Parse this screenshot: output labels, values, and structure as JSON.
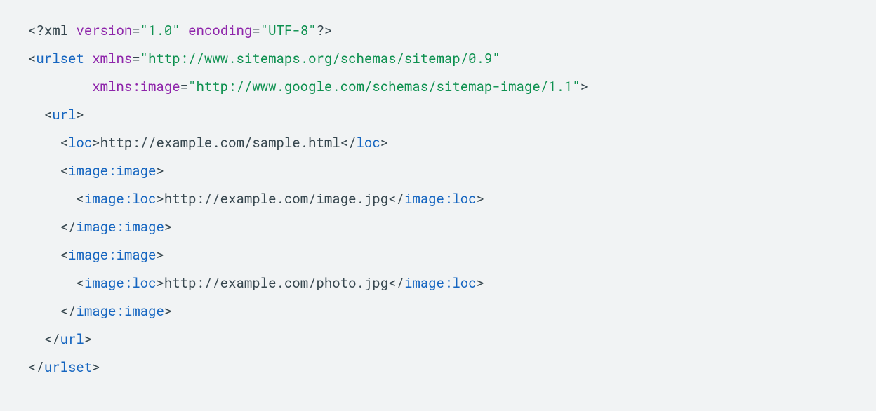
{
  "code": {
    "indent": "  ",
    "xml_decl": {
      "open": "<?",
      "name": "xml",
      "attrs": [
        {
          "name": "version",
          "value": "1.0"
        },
        {
          "name": "encoding",
          "value": "UTF-8"
        }
      ],
      "close": "?>"
    },
    "root": {
      "name": "urlset",
      "attrs": [
        {
          "name": "xmlns",
          "value": "http://www.sitemaps.org/schemas/sitemap/0.9",
          "align_col": 9
        },
        {
          "name": "xmlns:image",
          "value": "http://www.google.com/schemas/sitemap-image/1.1",
          "align_col": 9
        }
      ],
      "children": [
        {
          "name": "url",
          "children": [
            {
              "name": "loc",
              "text": "http://example.com/sample.html"
            },
            {
              "name": "image:image",
              "children": [
                {
                  "name": "image:loc",
                  "text": "http://example.com/image.jpg"
                }
              ]
            },
            {
              "name": "image:image",
              "children": [
                {
                  "name": "image:loc",
                  "text": "http://example.com/photo.jpg"
                }
              ]
            }
          ]
        }
      ]
    }
  }
}
